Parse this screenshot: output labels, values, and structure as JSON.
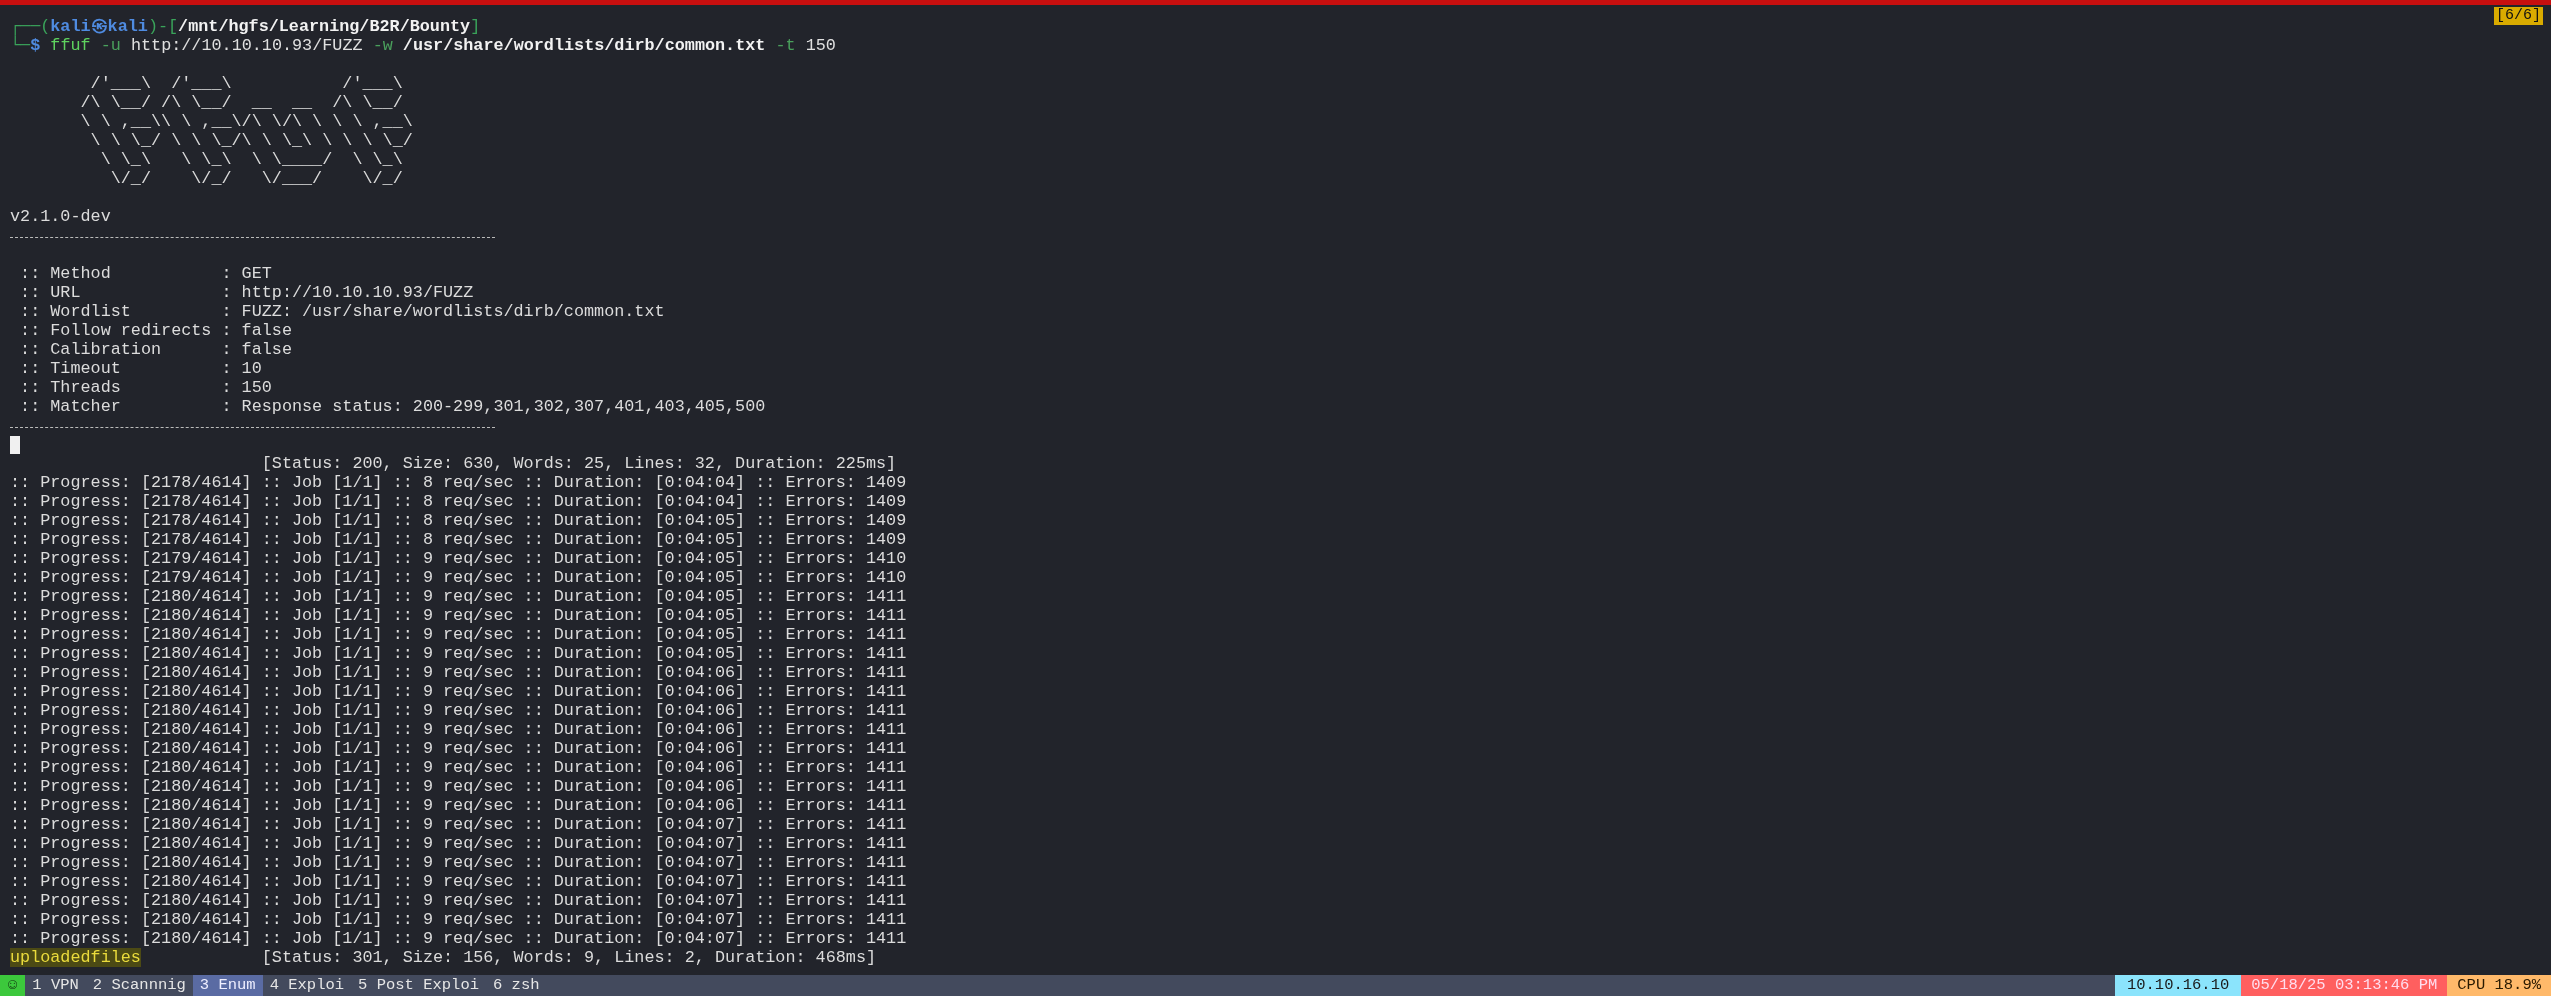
{
  "tab_indicator": "[6/6]",
  "prompt": {
    "line1": [
      {
        "text": "┌──(",
        "kind": "frame"
      },
      {
        "text": "kali㉿kali",
        "kind": "user"
      },
      {
        "text": ")-[",
        "kind": "frame"
      },
      {
        "text": "/mnt/hgfs/Learning/B2R/Bounty",
        "kind": "path"
      },
      {
        "text": "]",
        "kind": "frame"
      }
    ],
    "line2": [
      {
        "text": "└─",
        "kind": "frame"
      },
      {
        "text": "$",
        "kind": "symbol"
      }
    ],
    "command": [
      {
        "text": "ffuf",
        "kind": "cmd"
      },
      {
        "text": "-u",
        "kind": "opt"
      },
      {
        "text": "http://10.10.10.93/FUZZ",
        "kind": "arg"
      },
      {
        "text": "-w",
        "kind": "opt"
      },
      {
        "text": "/usr/share/wordlists/dirb/common.txt",
        "kind": "path"
      },
      {
        "text": "-t",
        "kind": "opt"
      },
      {
        "text": "150",
        "kind": "arg"
      }
    ]
  },
  "banner": [
    "        /'___\\  /'___\\           /'___\\",
    "       /\\ \\__/ /\\ \\__/  __  __  /\\ \\__/",
    "       \\ \\ ,__\\\\ \\ ,__\\/\\ \\/\\ \\ \\ \\ ,__\\",
    "        \\ \\ \\_/ \\ \\ \\_/\\ \\ \\_\\ \\ \\ \\ \\_/",
    "         \\ \\_\\   \\ \\_\\  \\ \\____/  \\ \\_\\",
    "          \\/_/    \\/_/   \\/___/    \\/_/"
  ],
  "version": "v2.1.0-dev",
  "settings": [
    " :: Method           : GET",
    " :: URL              : http://10.10.10.93/FUZZ",
    " :: Wordlist         : FUZZ: /usr/share/wordlists/dirb/common.txt",
    " :: Follow redirects : false",
    " :: Calibration      : false",
    " :: Timeout          : 10",
    " :: Threads          : 150",
    " :: Matcher          : Response status: 200-299,301,302,307,401,403,405,500"
  ],
  "results_top": [
    {
      "info": "[Status: 200, Size: 630, Words: 25, Lines: 32, Duration: 225ms]"
    }
  ],
  "progress": [
    ":: Progress: [2178/4614] :: Job [1/1] :: 8 req/sec :: Duration: [0:04:04] :: Errors: 1409",
    ":: Progress: [2178/4614] :: Job [1/1] :: 8 req/sec :: Duration: [0:04:04] :: Errors: 1409",
    ":: Progress: [2178/4614] :: Job [1/1] :: 8 req/sec :: Duration: [0:04:05] :: Errors: 1409",
    ":: Progress: [2178/4614] :: Job [1/1] :: 8 req/sec :: Duration: [0:04:05] :: Errors: 1409",
    ":: Progress: [2179/4614] :: Job [1/1] :: 9 req/sec :: Duration: [0:04:05] :: Errors: 1410",
    ":: Progress: [2179/4614] :: Job [1/1] :: 9 req/sec :: Duration: [0:04:05] :: Errors: 1410",
    ":: Progress: [2180/4614] :: Job [1/1] :: 9 req/sec :: Duration: [0:04:05] :: Errors: 1411",
    ":: Progress: [2180/4614] :: Job [1/1] :: 9 req/sec :: Duration: [0:04:05] :: Errors: 1411",
    ":: Progress: [2180/4614] :: Job [1/1] :: 9 req/sec :: Duration: [0:04:05] :: Errors: 1411",
    ":: Progress: [2180/4614] :: Job [1/1] :: 9 req/sec :: Duration: [0:04:05] :: Errors: 1411",
    ":: Progress: [2180/4614] :: Job [1/1] :: 9 req/sec :: Duration: [0:04:06] :: Errors: 1411",
    ":: Progress: [2180/4614] :: Job [1/1] :: 9 req/sec :: Duration: [0:04:06] :: Errors: 1411",
    ":: Progress: [2180/4614] :: Job [1/1] :: 9 req/sec :: Duration: [0:04:06] :: Errors: 1411",
    ":: Progress: [2180/4614] :: Job [1/1] :: 9 req/sec :: Duration: [0:04:06] :: Errors: 1411",
    ":: Progress: [2180/4614] :: Job [1/1] :: 9 req/sec :: Duration: [0:04:06] :: Errors: 1411",
    ":: Progress: [2180/4614] :: Job [1/1] :: 9 req/sec :: Duration: [0:04:06] :: Errors: 1411",
    ":: Progress: [2180/4614] :: Job [1/1] :: 9 req/sec :: Duration: [0:04:06] :: Errors: 1411",
    ":: Progress: [2180/4614] :: Job [1/1] :: 9 req/sec :: Duration: [0:04:06] :: Errors: 1411",
    ":: Progress: [2180/4614] :: Job [1/1] :: 9 req/sec :: Duration: [0:04:07] :: Errors: 1411",
    ":: Progress: [2180/4614] :: Job [1/1] :: 9 req/sec :: Duration: [0:04:07] :: Errors: 1411",
    ":: Progress: [2180/4614] :: Job [1/1] :: 9 req/sec :: Duration: [0:04:07] :: Errors: 1411",
    ":: Progress: [2180/4614] :: Job [1/1] :: 9 req/sec :: Duration: [0:04:07] :: Errors: 1411",
    ":: Progress: [2180/4614] :: Job [1/1] :: 9 req/sec :: Duration: [0:04:07] :: Errors: 1411",
    ":: Progress: [2180/4614] :: Job [1/1] :: 9 req/sec :: Duration: [0:04:07] :: Errors: 1411",
    ":: Progress: [2180/4614] :: Job [1/1] :: 9 req/sec :: Duration: [0:04:07] :: Errors: 1411"
  ],
  "results_bottom": [
    {
      "word": "uploadedfiles",
      "info": "[Status: 301, Size: 156, Words: 9, Lines: 2, Duration: 468ms]"
    }
  ],
  "status_bar": {
    "session_icon": "☺",
    "windows": [
      {
        "number": "1",
        "name": "VPN",
        "selected": false
      },
      {
        "number": "2",
        "name": "Scannnig",
        "selected": false
      },
      {
        "number": "3",
        "name": "Enum",
        "selected": true
      },
      {
        "number": "4",
        "name": "Exploi",
        "selected": false
      },
      {
        "number": "5",
        "name": "Post Exploi",
        "selected": false
      },
      {
        "number": "6",
        "name": "zsh",
        "selected": false
      }
    ],
    "ip": "10.10.16.10",
    "datetime": "05/18/25 03:13:46 PM",
    "cpu": "CPU 18.9%"
  }
}
